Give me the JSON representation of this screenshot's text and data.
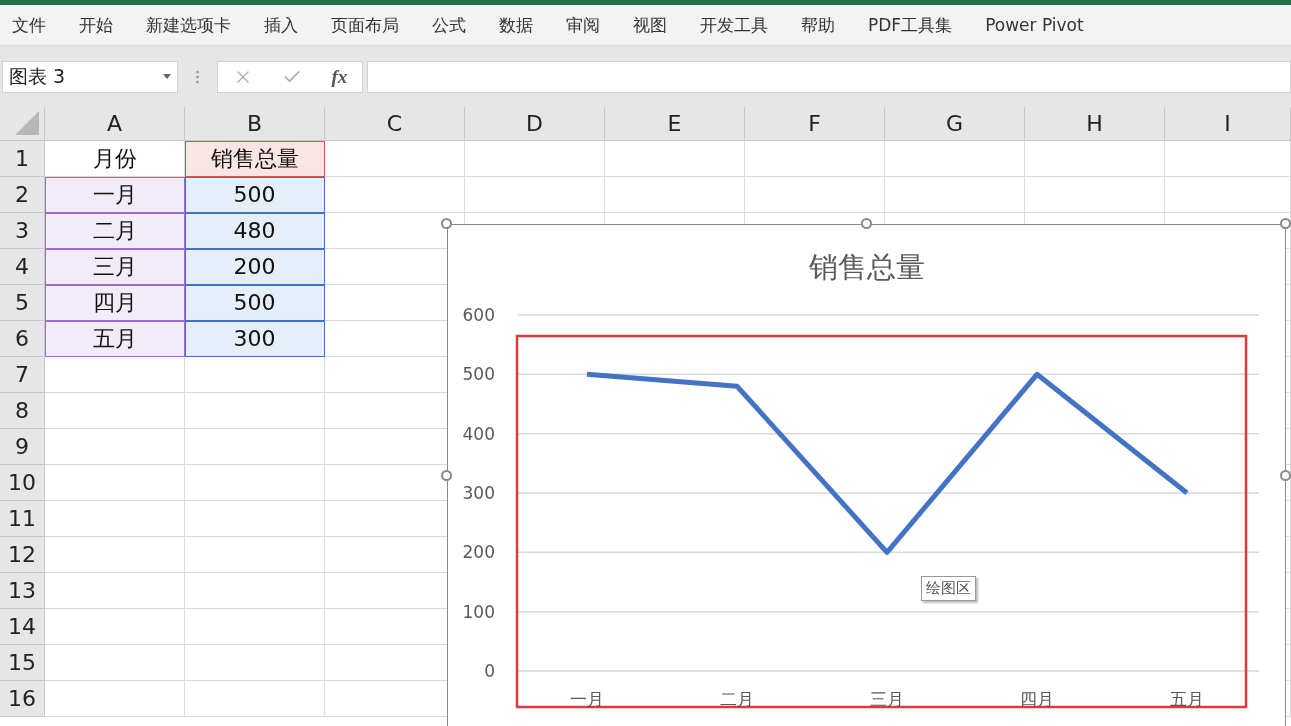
{
  "ribbon": {
    "tabs": [
      {
        "label": "文件"
      },
      {
        "label": "开始"
      },
      {
        "label": "新建选项卡"
      },
      {
        "label": "插入"
      },
      {
        "label": "页面布局"
      },
      {
        "label": "公式"
      },
      {
        "label": "数据"
      },
      {
        "label": "审阅"
      },
      {
        "label": "视图"
      },
      {
        "label": "开发工具"
      },
      {
        "label": "帮助"
      },
      {
        "label": "PDF工具集"
      },
      {
        "label": "Power Pivot"
      }
    ]
  },
  "name_box": {
    "value": "图表 3"
  },
  "formula_bar": {
    "function_label": "fx"
  },
  "sheet": {
    "columns": [
      "A",
      "B",
      "C",
      "D",
      "E",
      "F",
      "G",
      "H",
      "I"
    ],
    "rows": [
      {
        "number": "1",
        "cells": [
          {
            "text": "月份",
            "kind": "plain"
          },
          {
            "text": "销售总量",
            "kind": "series"
          }
        ]
      },
      {
        "number": "2",
        "cells": [
          {
            "text": "一月",
            "kind": "category"
          },
          {
            "text": "500",
            "kind": "value"
          }
        ]
      },
      {
        "number": "3",
        "cells": [
          {
            "text": "二月",
            "kind": "category"
          },
          {
            "text": "480",
            "kind": "value"
          }
        ]
      },
      {
        "number": "4",
        "cells": [
          {
            "text": "三月",
            "kind": "category"
          },
          {
            "text": "200",
            "kind": "value"
          }
        ]
      },
      {
        "number": "5",
        "cells": [
          {
            "text": "四月",
            "kind": "category"
          },
          {
            "text": "500",
            "kind": "value"
          }
        ]
      },
      {
        "number": "6",
        "cells": [
          {
            "text": "五月",
            "kind": "category"
          },
          {
            "text": "300",
            "kind": "value"
          }
        ]
      },
      {
        "number": "7",
        "cells": []
      },
      {
        "number": "8",
        "cells": []
      },
      {
        "number": "9",
        "cells": []
      },
      {
        "number": "10",
        "cells": []
      },
      {
        "number": "11",
        "cells": []
      },
      {
        "number": "12",
        "cells": []
      },
      {
        "number": "13",
        "cells": []
      },
      {
        "number": "14",
        "cells": []
      },
      {
        "number": "15",
        "cells": []
      },
      {
        "number": "16",
        "cells": []
      }
    ]
  },
  "chart": {
    "tooltip": "绘图区",
    "chart_data": {
      "type": "line",
      "title": "销售总量",
      "categories": [
        "一月",
        "二月",
        "三月",
        "四月",
        "五月"
      ],
      "series": [
        {
          "color": "#4472c4",
          "values": [
            500,
            480,
            200,
            500,
            300
          ]
        }
      ],
      "grid": true,
      "ylim": [
        0,
        600
      ],
      "yticks": [
        0,
        100,
        200,
        300,
        400,
        500,
        600
      ]
    }
  }
}
